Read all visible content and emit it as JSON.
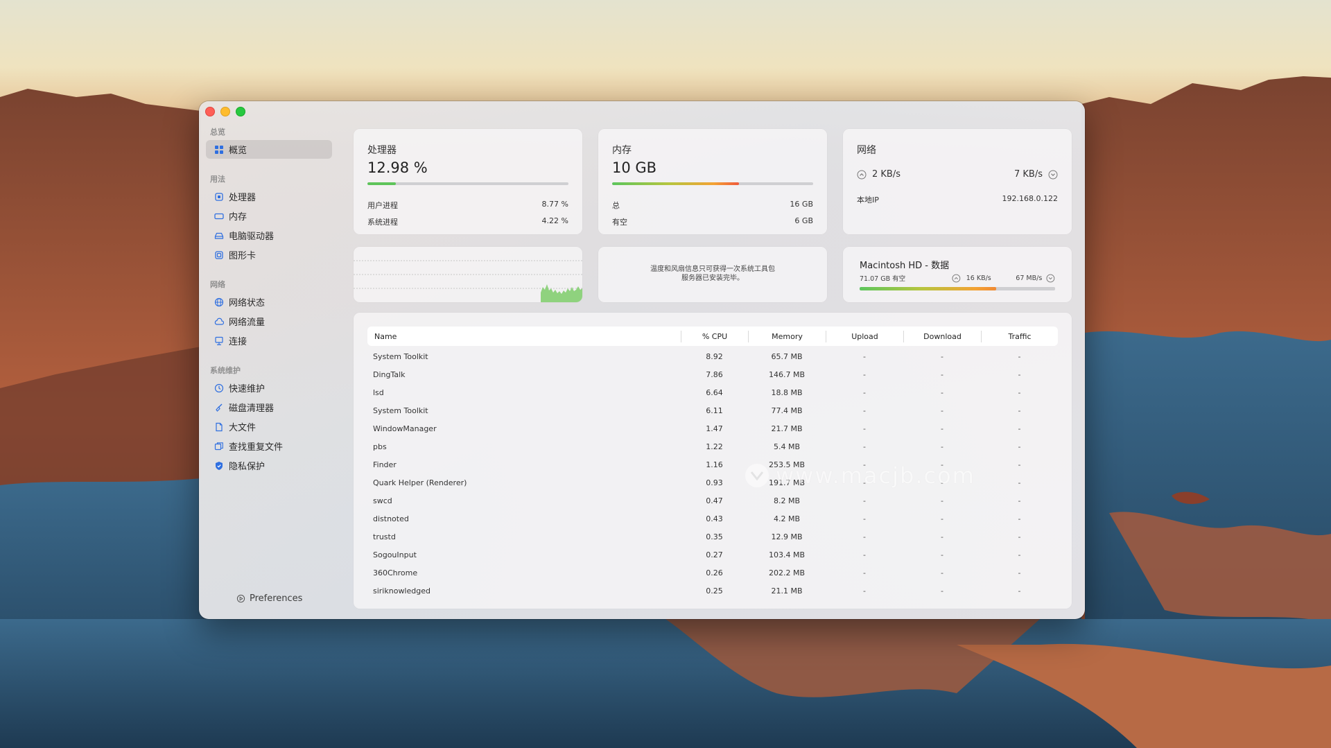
{
  "sidebar": {
    "sections": {
      "overview": "总览",
      "usage": "用法",
      "network": "网络",
      "maintenance": "系统维护"
    },
    "items": [
      {
        "label": "概览",
        "icon": "grid-icon"
      },
      {
        "label": "处理器",
        "icon": "cpu-icon"
      },
      {
        "label": "内存",
        "icon": "memory-icon"
      },
      {
        "label": "电脑驱动器",
        "icon": "drive-icon"
      },
      {
        "label": "图形卡",
        "icon": "gpu-icon"
      },
      {
        "label": "网络状态",
        "icon": "globe-icon"
      },
      {
        "label": "网络流量",
        "icon": "cloud-icon"
      },
      {
        "label": "连接",
        "icon": "monitor-icon"
      },
      {
        "label": "快速维护",
        "icon": "clock-icon"
      },
      {
        "label": "磁盘清理器",
        "icon": "broom-icon"
      },
      {
        "label": "大文件",
        "icon": "file-icon"
      },
      {
        "label": "查找重复文件",
        "icon": "duplicate-icon"
      },
      {
        "label": "隐私保护",
        "icon": "shield-icon"
      }
    ],
    "preferences": "Preferences"
  },
  "cpu": {
    "title": "处理器",
    "value": "12.98 %",
    "usage_fraction": 0.14,
    "user_label": "用户进程",
    "user_value": "8.77 %",
    "system_label": "系统进程",
    "system_value": "4.22 %"
  },
  "memory": {
    "title": "内存",
    "value": "10 GB",
    "usage_fraction": 0.63,
    "total_label": "总",
    "total_value": "16 GB",
    "free_label": "有空",
    "free_value": "6 GB"
  },
  "network": {
    "title": "网络",
    "upload": "2 KB/s",
    "download": "7 KB/s",
    "ip_label": "本地IP",
    "ip_value": "192.168.0.122"
  },
  "sensor_notice": {
    "line1": "温度和风扇信息只可获得一次系统工具包",
    "line2": "服务器已安装完毕。"
  },
  "disk": {
    "title": "Macintosh HD - 数据",
    "free": "71.07 GB 有空",
    "read": "16 KB/s",
    "write": "67 MB/s",
    "usage_fraction": 0.7
  },
  "table": {
    "headers": {
      "name": "Name",
      "cpu": "% CPU",
      "memory": "Memory",
      "upload": "Upload",
      "download": "Download",
      "traffic": "Traffic"
    },
    "rows": [
      {
        "name": "System Toolkit",
        "cpu": "8.92",
        "memory": "65.7 MB",
        "upload": "-",
        "download": "-",
        "traffic": "-"
      },
      {
        "name": "DingTalk",
        "cpu": "7.86",
        "memory": "146.7 MB",
        "upload": "-",
        "download": "-",
        "traffic": "-"
      },
      {
        "name": "lsd",
        "cpu": "6.64",
        "memory": "18.8 MB",
        "upload": "-",
        "download": "-",
        "traffic": "-"
      },
      {
        "name": "System Toolkit",
        "cpu": "6.11",
        "memory": "77.4 MB",
        "upload": "-",
        "download": "-",
        "traffic": "-"
      },
      {
        "name": "WindowManager",
        "cpu": "1.47",
        "memory": "21.7 MB",
        "upload": "-",
        "download": "-",
        "traffic": "-"
      },
      {
        "name": "pbs",
        "cpu": "1.22",
        "memory": "5.4 MB",
        "upload": "-",
        "download": "-",
        "traffic": "-"
      },
      {
        "name": "Finder",
        "cpu": "1.16",
        "memory": "253.5 MB",
        "upload": "-",
        "download": "-",
        "traffic": "-"
      },
      {
        "name": "Quark Helper (Renderer)",
        "cpu": "0.93",
        "memory": "191.7 MB",
        "upload": "-",
        "download": "-",
        "traffic": "-"
      },
      {
        "name": "swcd",
        "cpu": "0.47",
        "memory": "8.2 MB",
        "upload": "-",
        "download": "-",
        "traffic": "-"
      },
      {
        "name": "distnoted",
        "cpu": "0.43",
        "memory": "4.2 MB",
        "upload": "-",
        "download": "-",
        "traffic": "-"
      },
      {
        "name": "trustd",
        "cpu": "0.35",
        "memory": "12.9 MB",
        "upload": "-",
        "download": "-",
        "traffic": "-"
      },
      {
        "name": "SogouInput",
        "cpu": "0.27",
        "memory": "103.4 MB",
        "upload": "-",
        "download": "-",
        "traffic": "-"
      },
      {
        "name": "360Chrome",
        "cpu": "0.26",
        "memory": "202.2 MB",
        "upload": "-",
        "download": "-",
        "traffic": "-"
      },
      {
        "name": "siriknowledged",
        "cpu": "0.25",
        "memory": "21.1 MB",
        "upload": "-",
        "download": "-",
        "traffic": "-"
      }
    ]
  },
  "watermark": "www.macjb.com",
  "colors": {
    "accent": "#3478f6",
    "cpu_bar": "#5ec45a",
    "memory_gradient": [
      "#5cc55c",
      "#f3a234",
      "#f05a3c"
    ],
    "graph_fill": "#8fd27e"
  }
}
